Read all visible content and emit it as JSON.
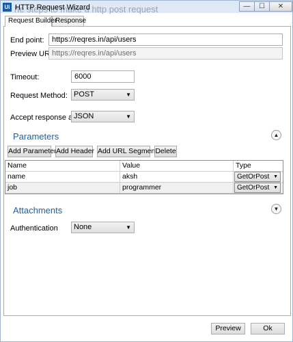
{
  "window": {
    "background_text": "he steps to make a http post request",
    "app_icon": "Ui",
    "title": "HTTP Request Wizard",
    "buttons": {
      "minimize": "—",
      "maximize": "☐",
      "close": "✕"
    }
  },
  "tabs": [
    {
      "label": "Request Builder",
      "active": true
    },
    {
      "label": "Response",
      "active": false
    }
  ],
  "form": {
    "endpoint_label": "End point:",
    "endpoint_value": "https://reqres.in/api/users",
    "preview_url_label": "Preview URL:",
    "preview_url_value": "https://reqres.in/api/users",
    "timeout_label": "Timeout:",
    "timeout_value": "6000",
    "method_label": "Request Method:",
    "method_value": "POST",
    "accept_label": "Accept response as:",
    "accept_value": "JSON"
  },
  "parameters": {
    "title": "Parameters",
    "expander_icon": "chevron-up",
    "buttons": {
      "add_parameter": "Add Parameter",
      "add_header": "Add Header",
      "add_url_segment": "Add URL Segment",
      "delete": "Delete"
    },
    "columns": [
      "Name",
      "Value",
      "Type"
    ],
    "rows": [
      {
        "name": "name",
        "value": "aksh",
        "type": "GetOrPost"
      },
      {
        "name": "job",
        "value": "programmer",
        "type": "GetOrPost"
      }
    ]
  },
  "attachments": {
    "title": "Attachments",
    "expander_icon": "chevron-down",
    "auth_label": "Authentication",
    "auth_value": "None"
  },
  "footer": {
    "preview_label": "Preview",
    "ok_label": "Ok"
  },
  "colors": {
    "accent": "#1f5fa3",
    "titlebar": "#dfe9f6"
  }
}
